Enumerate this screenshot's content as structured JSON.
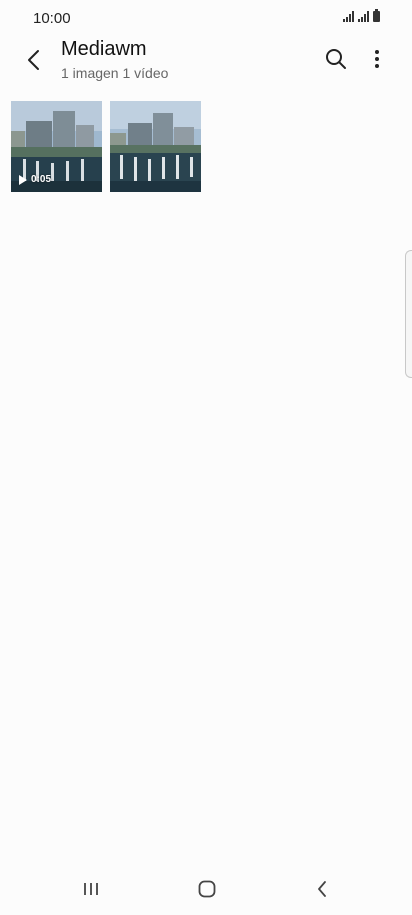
{
  "status_bar": {
    "time": "10:00"
  },
  "header": {
    "title": "Mediawm",
    "subtitle": "1 imagen 1 vídeo"
  },
  "items": [
    {
      "type": "video",
      "duration": "0:05"
    },
    {
      "type": "image"
    }
  ],
  "icons": {
    "back": "back-arrow-icon",
    "search": "search-icon",
    "more": "more-options-icon",
    "nav_recents": "recents-icon",
    "nav_home": "home-icon",
    "nav_back": "back-icon"
  }
}
